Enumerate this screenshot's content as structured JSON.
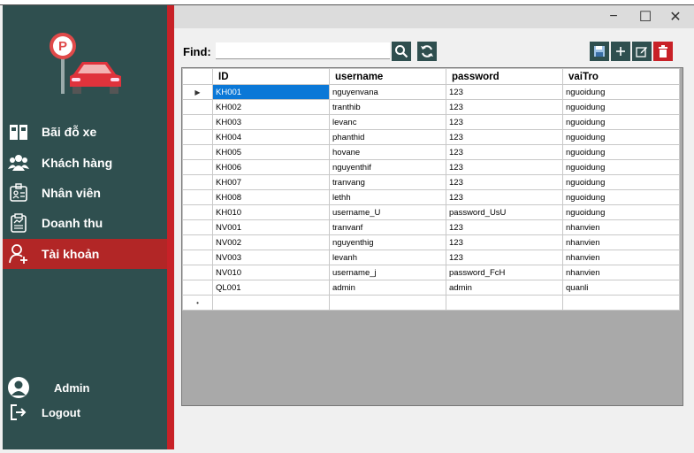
{
  "sidebar": {
    "nav": [
      {
        "label": "Bãi đỗ xe",
        "icon": "parking-lot-icon"
      },
      {
        "label": "Khách hàng",
        "icon": "customers-icon"
      },
      {
        "label": "Nhân viên",
        "icon": "employee-badge-icon"
      },
      {
        "label": "Doanh thu",
        "icon": "revenue-clipboard-icon"
      },
      {
        "label": "Tài khoản",
        "icon": "add-user-icon",
        "active": true
      }
    ],
    "user_name": "Admin",
    "logout_label": "Logout"
  },
  "window": {
    "minimize": "−",
    "maximize": "☐",
    "close": "✕"
  },
  "search": {
    "label": "Find:",
    "value": ""
  },
  "colors": {
    "sidebar": "#2f4f4f",
    "accent": "#c82127",
    "active": "#b22626",
    "selection": "#0b78d7"
  },
  "table": {
    "columns": [
      "ID",
      "username",
      "password",
      "vaiTro"
    ],
    "rows": [
      {
        "id": "KH001",
        "username": "nguyenvana",
        "password": "123",
        "role": "nguoidung"
      },
      {
        "id": "KH002",
        "username": "tranthib",
        "password": "123",
        "role": "nguoidung"
      },
      {
        "id": "KH003",
        "username": "levanc",
        "password": "123",
        "role": "nguoidung"
      },
      {
        "id": "KH004",
        "username": "phanthid",
        "password": "123",
        "role": "nguoidung"
      },
      {
        "id": "KH005",
        "username": "hovane",
        "password": "123",
        "role": "nguoidung"
      },
      {
        "id": "KH006",
        "username": "nguyenthif",
        "password": "123",
        "role": "nguoidung"
      },
      {
        "id": "KH007",
        "username": "tranvang",
        "password": "123",
        "role": "nguoidung"
      },
      {
        "id": "KH008",
        "username": "lethh",
        "password": "123",
        "role": "nguoidung"
      },
      {
        "id": "KH010",
        "username": "username_U",
        "password": "password_UsU",
        "role": "nguoidung"
      },
      {
        "id": "NV001",
        "username": "tranvanf",
        "password": "123",
        "role": "nhanvien"
      },
      {
        "id": "NV002",
        "username": "nguyenthig",
        "password": "123",
        "role": "nhanvien"
      },
      {
        "id": "NV003",
        "username": "levanh",
        "password": "123",
        "role": "nhanvien"
      },
      {
        "id": "NV010",
        "username": "username_j",
        "password": "password_FcH",
        "role": "nhanvien"
      },
      {
        "id": "QL001",
        "username": "admin",
        "password": "admin",
        "role": "quanli"
      }
    ]
  }
}
